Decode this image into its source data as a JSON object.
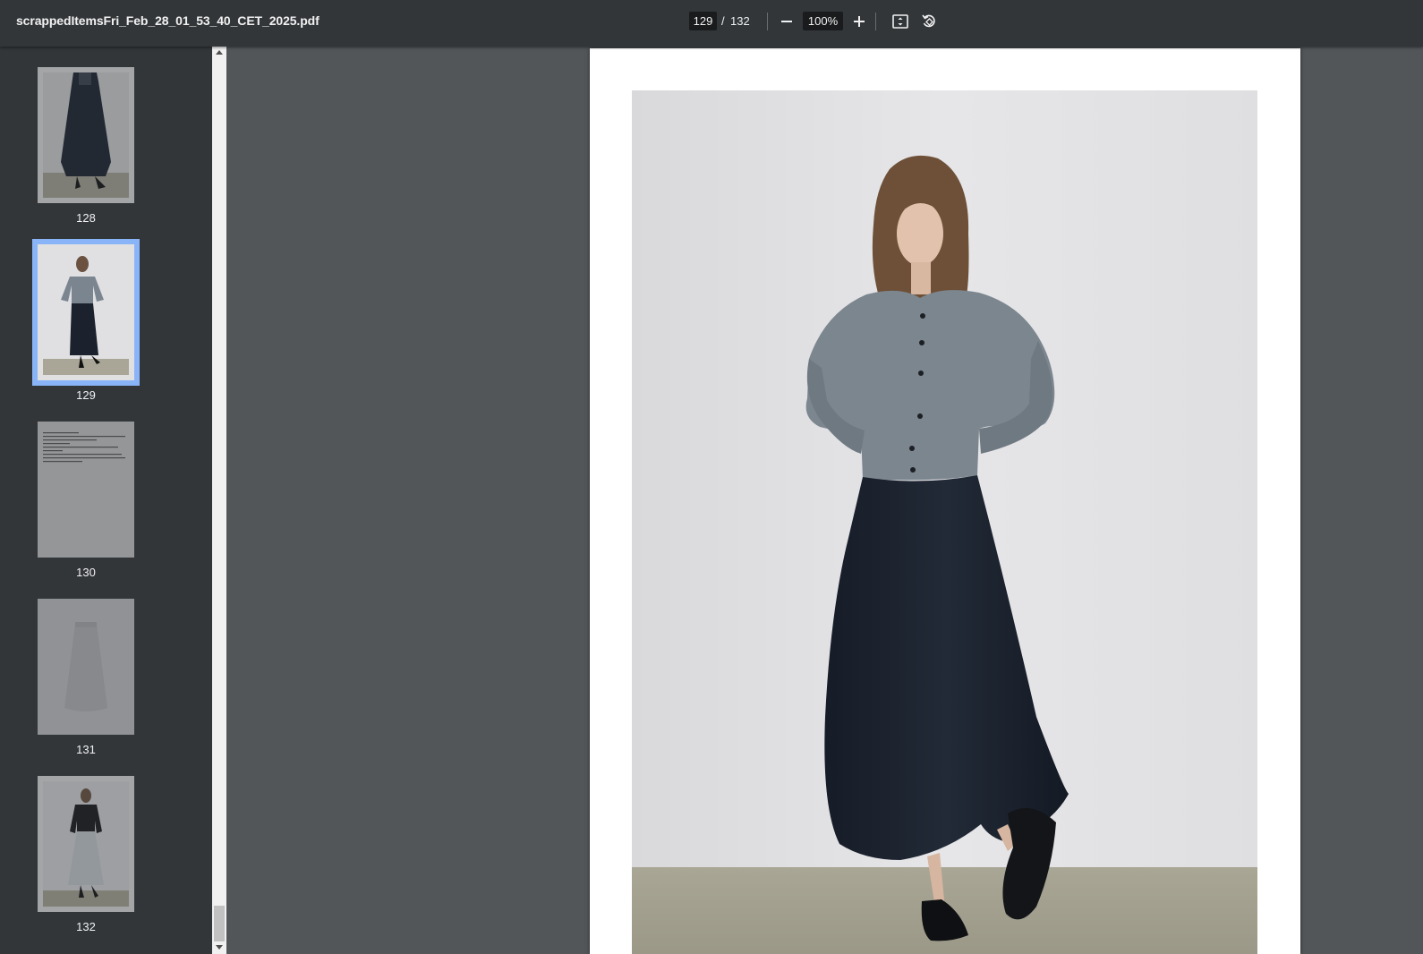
{
  "toolbar": {
    "title": "scrappedItemsFri_Feb_28_01_53_40_CET_2025.pdf",
    "current_page": "129",
    "separator": "/",
    "total_pages": "132",
    "zoom": "100%"
  },
  "thumbnails": [
    {
      "label": "128"
    },
    {
      "label": "129"
    },
    {
      "label": "130"
    },
    {
      "label": "131"
    },
    {
      "label": "132"
    }
  ],
  "colors": {
    "toolbar_bg": "#323639",
    "viewer_bg": "#525659",
    "selection": "#8ab4f8"
  }
}
